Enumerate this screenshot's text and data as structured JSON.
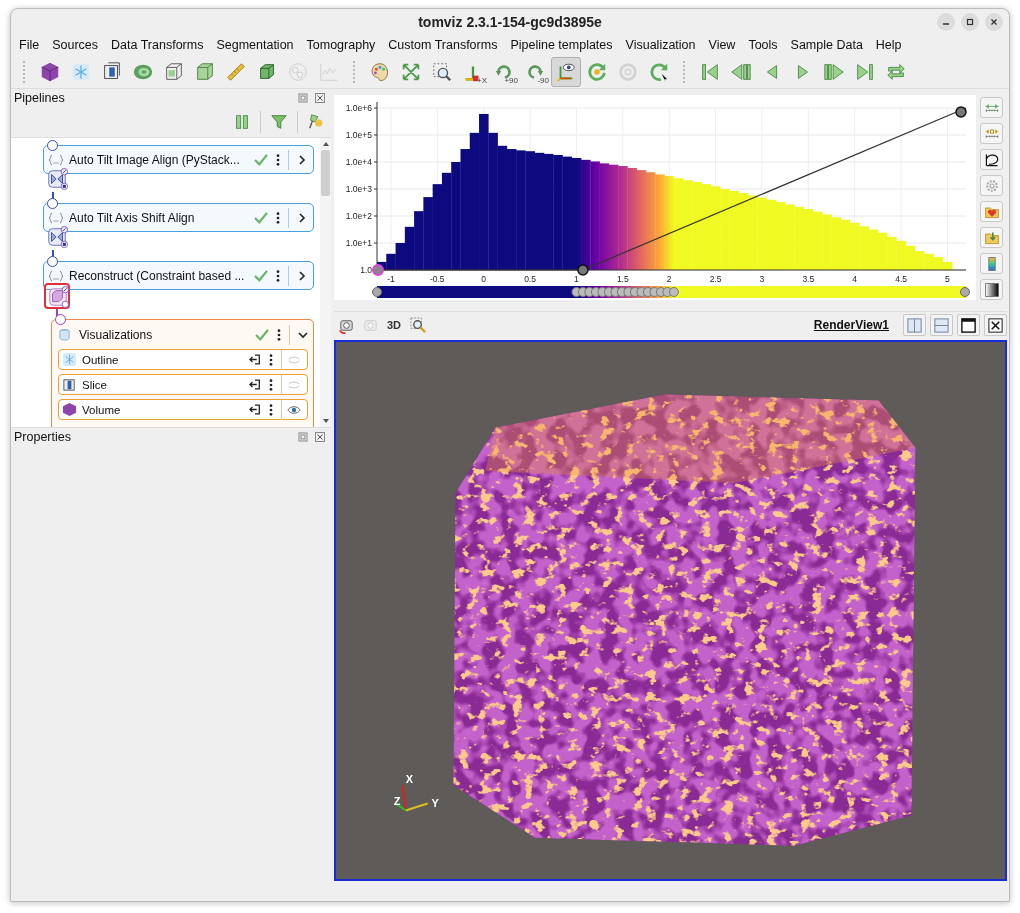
{
  "window": {
    "title": "tomviz 2.3.1-154-gc9d3895e"
  },
  "menu": [
    {
      "label": "File"
    },
    {
      "label": "Sources"
    },
    {
      "label": "Data Transforms"
    },
    {
      "label": "Segmentation"
    },
    {
      "label": "Tomography"
    },
    {
      "label": "Custom Transforms"
    },
    {
      "label": "Pipeline templates"
    },
    {
      "label": "Visualization"
    },
    {
      "label": "View"
    },
    {
      "label": "Tools"
    },
    {
      "label": "Sample Data"
    },
    {
      "label": "Help"
    }
  ],
  "toolbar": [
    {
      "items": [
        {
          "kind": "cube",
          "disabled": false,
          "pressed": false
        },
        {
          "kind": "snowflake",
          "disabled": false,
          "pressed": false
        },
        {
          "kind": "slice-box",
          "disabled": false,
          "pressed": false
        },
        {
          "kind": "ring",
          "disabled": false,
          "pressed": false
        },
        {
          "kind": "wire-box",
          "disabled": false,
          "pressed": false
        },
        {
          "kind": "solid-box",
          "disabled": false,
          "pressed": false
        },
        {
          "kind": "ruler",
          "disabled": false,
          "pressed": false
        },
        {
          "kind": "clip-box",
          "disabled": false,
          "pressed": false
        },
        {
          "kind": "circles",
          "disabled": true,
          "pressed": false
        },
        {
          "kind": "line-chart",
          "disabled": true,
          "pressed": false
        }
      ]
    },
    {
      "items": [
        {
          "kind": "palette",
          "disabled": false,
          "pressed": false
        },
        {
          "kind": "expand-arrows",
          "disabled": false,
          "pressed": false
        },
        {
          "kind": "zoom-box",
          "disabled": false,
          "pressed": false
        },
        {
          "kind": "axis-arrows",
          "label": "+X",
          "disabled": false,
          "pressed": false
        },
        {
          "kind": "rotate-cw",
          "label": "+90",
          "disabled": false,
          "pressed": false
        },
        {
          "kind": "rotate-ccw",
          "label": "-90",
          "disabled": false,
          "pressed": false
        },
        {
          "kind": "axes-eye",
          "disabled": false,
          "pressed": true
        },
        {
          "kind": "reset-camera",
          "disabled": false,
          "pressed": false
        },
        {
          "kind": "target",
          "disabled": true,
          "pressed": false
        },
        {
          "kind": "rotate-cursor",
          "disabled": false,
          "pressed": false
        }
      ]
    },
    {
      "items": [
        {
          "kind": "first",
          "disabled": false,
          "pressed": false
        },
        {
          "kind": "step-back",
          "disabled": false,
          "pressed": false
        },
        {
          "kind": "back",
          "disabled": false,
          "pressed": false
        },
        {
          "kind": "play",
          "disabled": false,
          "pressed": false
        },
        {
          "kind": "step-forward",
          "disabled": false,
          "pressed": false
        },
        {
          "kind": "last",
          "disabled": false,
          "pressed": false
        },
        {
          "kind": "loop",
          "disabled": false,
          "pressed": false
        }
      ]
    }
  ],
  "pipelines": {
    "title": "Pipelines",
    "nodes": [
      {
        "label": "Auto Tilt Image Align (PyStack...",
        "completed": true,
        "expanded": false,
        "output": {
          "kind": "tilt-series",
          "selected": false
        }
      },
      {
        "label": "Auto Tilt Axis Shift Align",
        "completed": true,
        "expanded": false,
        "output": {
          "kind": "tilt-series",
          "selected": false
        }
      },
      {
        "label": "Reconstruct (Constraint based ...",
        "completed": true,
        "expanded": false,
        "output": {
          "kind": "volume",
          "selected": true,
          "children": [
            {
              "label": "Visualizations",
              "completed": true,
              "expanded": true,
              "children": [
                {
                  "kind": "outline",
                  "label": "Outline",
                  "visible": false
                },
                {
                  "kind": "slice",
                  "label": "Slice",
                  "visible": false
                },
                {
                  "kind": "volume",
                  "label": "Volume",
                  "visible": true
                }
              ]
            }
          ]
        }
      }
    ]
  },
  "properties": {
    "title": "Properties"
  },
  "histogram": {
    "x_axis_labels": [
      "-1",
      "-0.5",
      "0",
      "0.5",
      "1",
      "1.5",
      "2",
      "2.5",
      "3",
      "3.5",
      "4",
      "4.5",
      "5"
    ],
    "y_axis_labels": [
      "1.0e+6",
      "1.0e+5",
      "1.0e+4",
      "1.0e+3",
      "1.0e+2",
      "1.0e+1",
      "1.0"
    ],
    "side_buttons": [
      {
        "kind": "range-reset"
      },
      {
        "kind": "range-custom"
      },
      {
        "kind": "curve"
      },
      {
        "kind": "gear"
      },
      {
        "kind": "heart-folder"
      },
      {
        "kind": "save-folder"
      },
      {
        "kind": "color-legend"
      },
      {
        "kind": "gradient"
      }
    ]
  },
  "render_toolbar": [
    {
      "kind": "camera-undo",
      "disabled": false
    },
    {
      "kind": "camera-redo",
      "disabled": true
    },
    {
      "kind": "text",
      "label": "3D",
      "disabled": false
    },
    {
      "kind": "zoom-select",
      "disabled": false
    }
  ],
  "view": {
    "label": "RenderView1",
    "buttons": [
      {
        "kind": "split-h"
      },
      {
        "kind": "split-v"
      },
      {
        "kind": "maximize"
      },
      {
        "kind": "close"
      }
    ]
  },
  "orientation_axes": [
    {
      "label": "X",
      "color": "#e02020"
    },
    {
      "label": "Y",
      "color": "#d8c020"
    },
    {
      "label": "Z",
      "color": "#20c020"
    }
  ]
}
